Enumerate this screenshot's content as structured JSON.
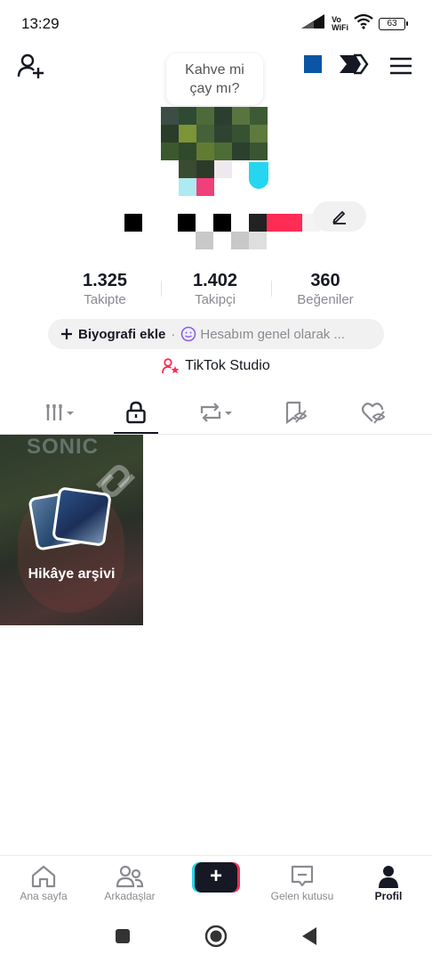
{
  "status_bar": {
    "time": "13:29",
    "network_label": "Vo WiFi",
    "battery": "63"
  },
  "header": {
    "bubble_line1": "Kahve mi",
    "bubble_line2": "çay mı?",
    "brand_square_color": "#0a56a4",
    "icons": [
      "add-friend-icon",
      "share-icon",
      "menu-icon"
    ]
  },
  "profile": {
    "stats": [
      {
        "value": "1.325",
        "label": "Takipte"
      },
      {
        "value": "1.402",
        "label": "Takipçi"
      },
      {
        "value": "360",
        "label": "Beğeniler"
      }
    ],
    "bio_add_label": "Biyografi ekle",
    "bio_separator": "·",
    "bio_text": "Hesabım genel olarak ...",
    "studio_label": "TikTok Studio"
  },
  "tabs": [
    {
      "icon": "videos-grid-icon",
      "active": false
    },
    {
      "icon": "lock-icon",
      "active": true
    },
    {
      "icon": "repost-icon",
      "active": false
    },
    {
      "icon": "hidden-favorites-icon",
      "active": false
    },
    {
      "icon": "hidden-likes-icon",
      "active": false
    }
  ],
  "grid": {
    "story_card_label": "Hikâye arşivi",
    "story_card_bg_text": "SONIC"
  },
  "bottom_nav": [
    {
      "label": "Ana sayfa",
      "icon": "home-icon",
      "active": false
    },
    {
      "label": "Arkadaşlar",
      "icon": "friends-icon",
      "active": false
    },
    {
      "label": "+",
      "icon": "create-icon",
      "active": false
    },
    {
      "label": "Gelen kutusu",
      "icon": "inbox-icon",
      "active": false
    },
    {
      "label": "Profil",
      "icon": "profile-icon",
      "active": true
    }
  ],
  "colors": {
    "accent_red": "#fe2c55",
    "accent_cyan": "#25d6f0",
    "text_primary": "#161823",
    "text_secondary": "#8a8b91"
  }
}
